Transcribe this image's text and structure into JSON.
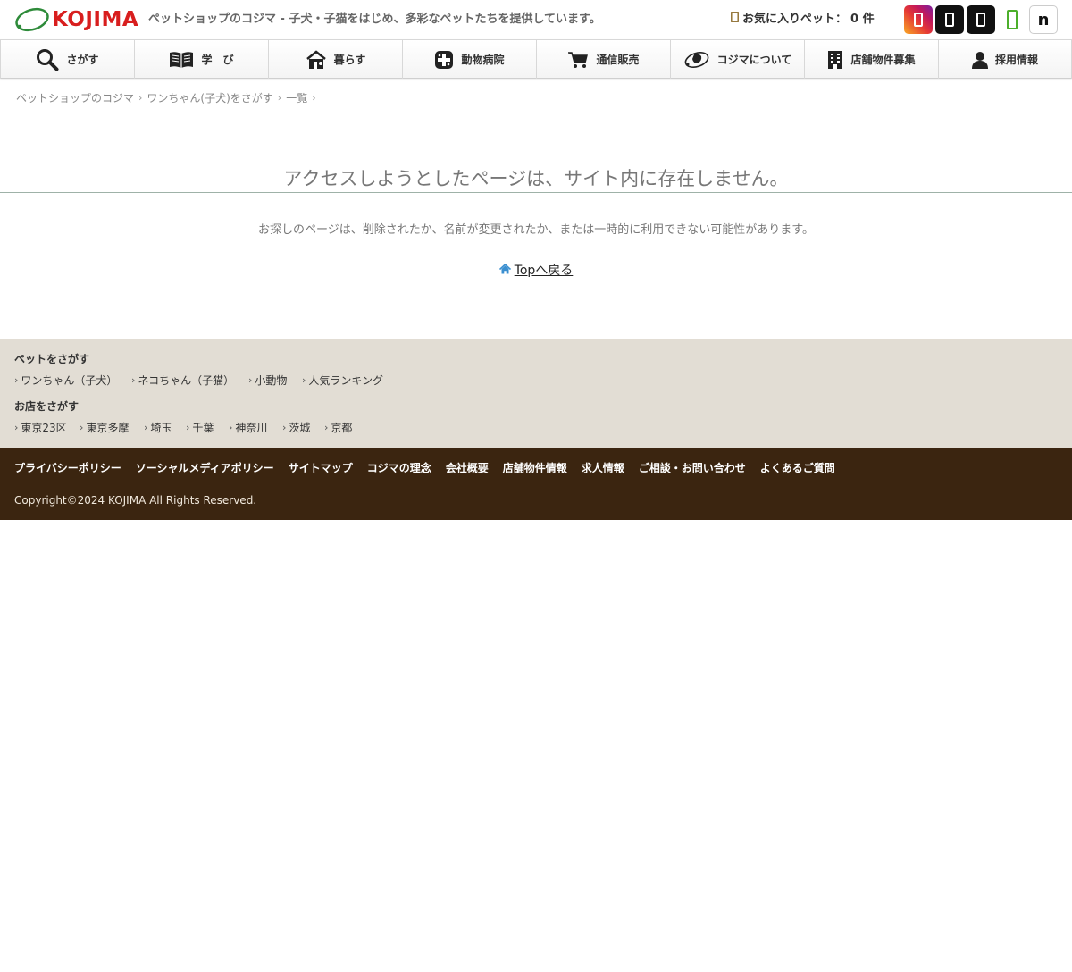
{
  "header": {
    "logo_text": "KOJIMA",
    "tagline": "ペットショップのコジマ - 子犬・子猫をはじめ、多彩なペットたちを提供しています。",
    "favorites_label": "お気に入りペット：",
    "favorites_count": "0 件",
    "social": [
      {
        "name": "instagram-icon",
        "color": "#e1306c"
      },
      {
        "name": "x-icon",
        "color": "#111111"
      },
      {
        "name": "tiktok-icon",
        "color": "#111111"
      },
      {
        "name": "line-icon",
        "color": "#4caf2b"
      },
      {
        "name": "note-icon",
        "glyph": "n"
      }
    ]
  },
  "nav": {
    "items": [
      {
        "label": "さがす",
        "icon": "search-icon"
      },
      {
        "label": "学　び",
        "icon": "book-icon"
      },
      {
        "label": "暮らす",
        "icon": "house-pet-icon"
      },
      {
        "label": "動物病院",
        "icon": "medical-cross-icon"
      },
      {
        "label": "通信販売",
        "icon": "cart-icon"
      },
      {
        "label": "コジマについて",
        "icon": "kojima-logo-icon"
      },
      {
        "label": "店舗物件募集",
        "icon": "building-icon"
      },
      {
        "label": "採用情報",
        "icon": "person-icon"
      }
    ]
  },
  "breadcrumb": [
    "ペットショップのコジマ",
    "ワンちゃん(子犬)をさがす",
    "一覧"
  ],
  "main": {
    "title": "アクセスしようとしたページは、サイト内に存在しません。",
    "description": "お探しのページは、削除されたか、名前が変更されたか、または一時的に利用できない可能性があります。",
    "top_link": "Topへ戻る"
  },
  "footer": {
    "pet_heading": "ペットをさがす",
    "pet_links": [
      "ワンちゃん（子犬）",
      "ネコちゃん（子猫）",
      "小動物",
      "人気ランキング"
    ],
    "store_heading": "お店をさがす",
    "store_links": [
      "東京23区",
      "東京多摩",
      "埼玉",
      "千葉",
      "神奈川",
      "茨城",
      "京都"
    ],
    "bottom_links": [
      "プライバシーポリシー",
      "ソーシャルメディアポリシー",
      "サイトマップ",
      "コジマの理念",
      "会社概要",
      "店舗物件情報",
      "求人情報",
      "ご相談・お問い合わせ",
      "よくあるご質問"
    ],
    "copyright": "Copyright©2024 KOJIMA All Rights Reserved."
  },
  "colors": {
    "brand_red": "#d81e1e",
    "brand_green": "#2e8b3a",
    "footer_light": "#e2ddd4",
    "footer_dark": "#3b2510"
  }
}
